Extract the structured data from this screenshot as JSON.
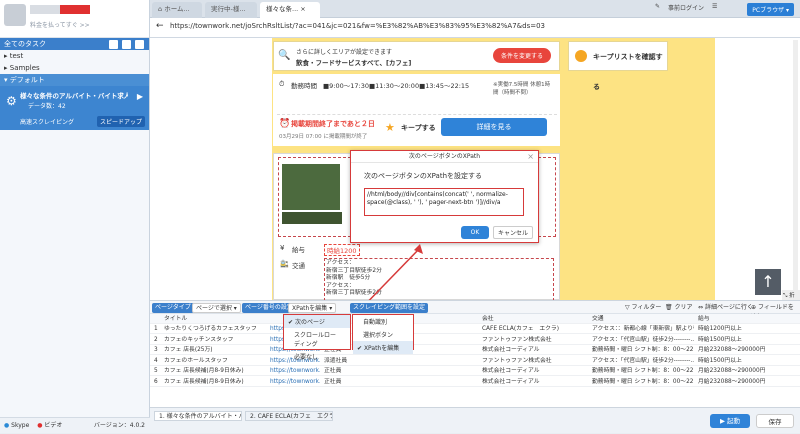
{
  "sidebar": {
    "promo": "料金を払ってすぐ >>",
    "all_tasks": "全てのタスク",
    "groups": [
      "test",
      "Samples"
    ],
    "default_group": "デフォルト",
    "task_name": "様々な条件のアルバイト・バイト求人情報...",
    "task_meta": "データ数：42",
    "task_mode": "高速スクレイピング",
    "speedup": "スピードアップ",
    "footer_skype": "Skype",
    "footer_video": "ビデオ",
    "version": "バージョン：4.0.2"
  },
  "tabs": {
    "items": [
      "ホーム...",
      "実行中-様...",
      "様々な条..."
    ],
    "account": "事前ログイン",
    "pc_browser": "PCブラウザ"
  },
  "url": "https://townwork.net/joSrchRsltList/?ac=041&jc=021&fw=%E3%82%AB%E3%83%95%E3%82%A7&ds=03",
  "page": {
    "area_line1": "さらに詳しくエリアが設定できます",
    "area_line2": "飲食・フードサービスすべて、[カフェ]",
    "change_cond": "条件を変更する",
    "keep_list": "キープリストを確認する",
    "work_hours_label": "勤務時間",
    "work_hours": "■9:00～17:30■11:30～20:00■13:45～22:15",
    "work_hours_note": "※実働7.5時間 休憩1時間（時間不問）",
    "deadline": "掲載期間終了まであと２日",
    "deadline_date": "03月29日 07:00 に掲載期間が終了",
    "keep": "キープする",
    "detail": "詳細を見る",
    "salary_label": "給与",
    "salary": "時給1200",
    "traffic_label": "交通",
    "access_lines": [
      "アクセス：",
      "新宿三丁目駅徒歩2分",
      "新宿駅　徒歩5分",
      "アクセス：",
      "新宿三丁目駅徒歩2分"
    ]
  },
  "dialog": {
    "title": "次のページボタンのXPath",
    "prompt": "次のページボタンのXPathを設定する",
    "xpath": "//html/body//div[contains(concat(' ', normalize-space(@class), ' '), ' pager-next-btn ')]//div/a",
    "ok": "OK",
    "cancel": "キャンセル"
  },
  "toolbar": {
    "page_type": "ページタイプ",
    "page_select": "ページで選択",
    "page_btn": "ページ番号の設定",
    "xpath_edit": "XPathを編集",
    "scrape_range": "スクレイピング範囲を設定",
    "filter": "フィルター",
    "clear": "クリア",
    "export": "詳細ページに行く",
    "add_field": "フィールドを追加"
  },
  "dropdown_left": [
    "次のページ",
    "スクロールローディング",
    "必要なし"
  ],
  "dropdown_right": [
    "自動識別",
    "選択ボタン",
    "XPathを編集"
  ],
  "table": {
    "headers": [
      "タイトル",
      "",
      "",
      "会社",
      "交通",
      "給与"
    ],
    "rows": [
      [
        "ゆったりくつろげるカフェスタッフ",
        "https://townwork.net/...",
        "",
        "CAFE ECLA(カフェ　エクラ)",
        "アクセス：：新都心線「東新宿」駅より徒...",
        "時給1200円以上"
      ],
      [
        "カフェのキッチンスタッフ",
        "https://townwork.net/viewjob/jobid_...",
        "正社員",
        "ファントゥファン株式会社",
        "アクセス：「代官山駅」徒歩2分--------...",
        "時給1500円以上"
      ],
      [
        "カフェ 店長(25万)",
        "https://townwork.net/viewjob/jobid_1...",
        "正社員",
        "株式会社コーディアル",
        "勤務時間・曜日 シフト制：8：00～22：0...",
        "月給232088～290000円"
      ],
      [
        "カフェのホールスタッフ",
        "https://townwork.net/viewjob/jobid_2156...",
        "派遣社員",
        "ファントゥファン株式会社",
        "アクセス：「代官山駅」徒歩2分--------...",
        "時給1500円以上"
      ],
      [
        "カフェ 店長候補(月8-9日休み)",
        "https://townwork.net/viewjob/jobid_fe5622...",
        "正社員",
        "株式会社コーディアル",
        "勤務時間・曜日 シフト制：8：00～22：0...",
        "月給232088～290000円"
      ],
      [
        "カフェ 店長候補(月8-9日休み)",
        "https://townwork.net/viewjob/jobid_82369a...",
        "正社員",
        "株式会社コーディアル",
        "勤務時間・曜日 シフト制：8：00～22：0...",
        "月給232088～290000円"
      ]
    ]
  },
  "bottom": {
    "tab1": "1. 様々な条件のアルバイト・バイ...",
    "tab2": "2. CAFE ECLA(カフェ　エクラ)",
    "start": "起動",
    "save": "保存"
  }
}
